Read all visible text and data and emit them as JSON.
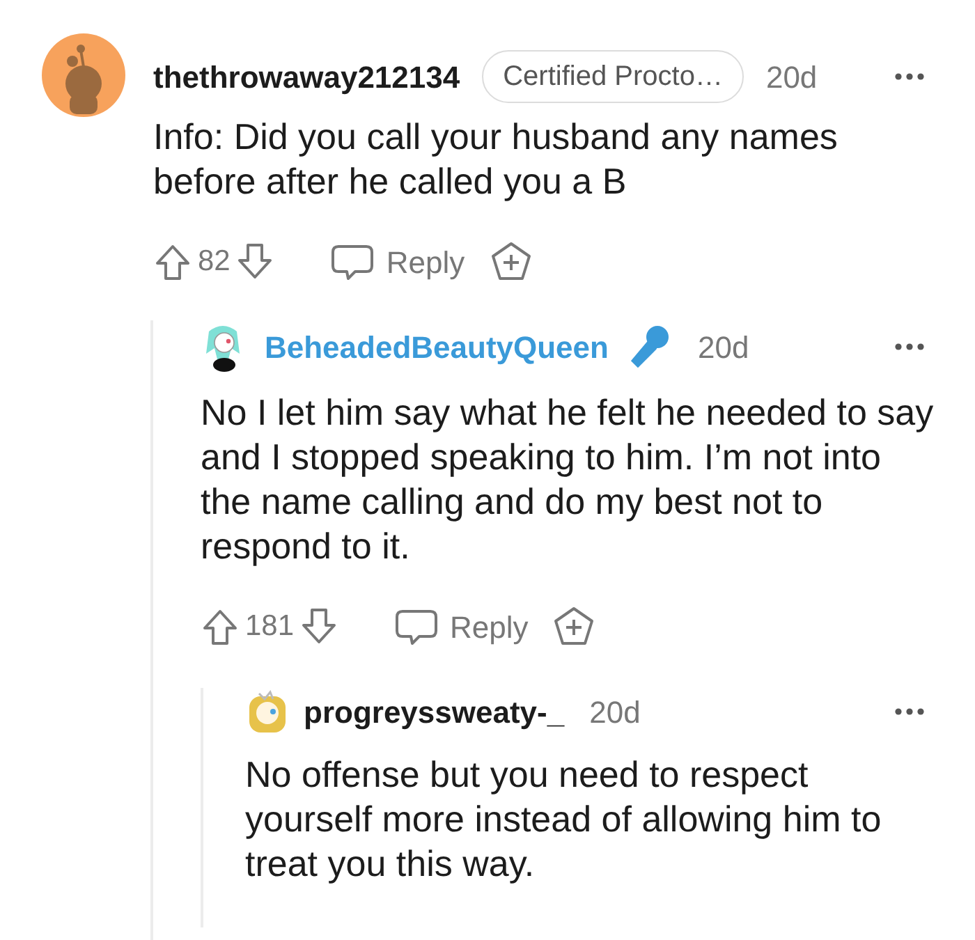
{
  "comments": [
    {
      "username": "thethrowaway212134",
      "op": false,
      "mic_flair": false,
      "flair": "Certified Procto…",
      "age": "20d",
      "body": "Info: Did you call your husband any names before after he called you a B",
      "votes": "82",
      "reply_label": "Reply",
      "children": [
        {
          "username": "BeheadedBeautyQueen",
          "op": true,
          "mic_flair": true,
          "age": "20d",
          "body": "No I let him say what he felt he needed to say and I stopped speaking to him. I’m not into the name calling and do my best not to respond to it.",
          "votes": "181",
          "reply_label": "Reply",
          "children": [
            {
              "username": "progreyssweaty-_",
              "op": false,
              "mic_flair": false,
              "age": "20d",
              "body": "No offense but you need to respect yourself more instead of allowing him to treat you this way."
            }
          ]
        }
      ]
    }
  ]
}
